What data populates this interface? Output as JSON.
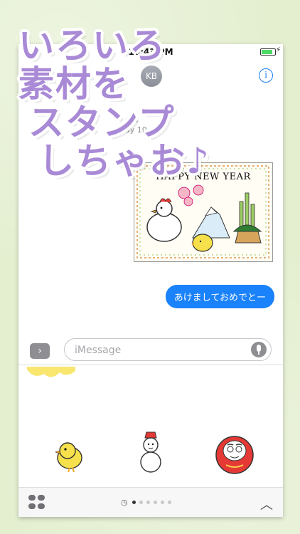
{
  "promo": {
    "line1": "いろいろ",
    "line2": "素材を",
    "line3": "スタンプ",
    "line4": "しちゃお♪"
  },
  "status_bar": {
    "time": "10:43 PM",
    "battery_level": 0.85
  },
  "contact": {
    "initials": "KB",
    "info_icon": "i"
  },
  "chat": {
    "timestamp_line1": "ssa",
    "timestamp_line2": "ay 10",
    "sticker_title": "HAPPY NEW YEAR",
    "sent_message": "あけましておめでとー"
  },
  "composer": {
    "apps_toggle": "›",
    "placeholder": "iMessage"
  },
  "drawer": {
    "stickers": [
      "chick-sticker",
      "snowman-sticker",
      "daruma-sticker"
    ],
    "recent_icon": "◷",
    "page_count": 6,
    "active_page": 0
  },
  "colors": {
    "accent": "#1a82fb",
    "promo_text": "#a98ad6",
    "background": "#e4efd0"
  }
}
